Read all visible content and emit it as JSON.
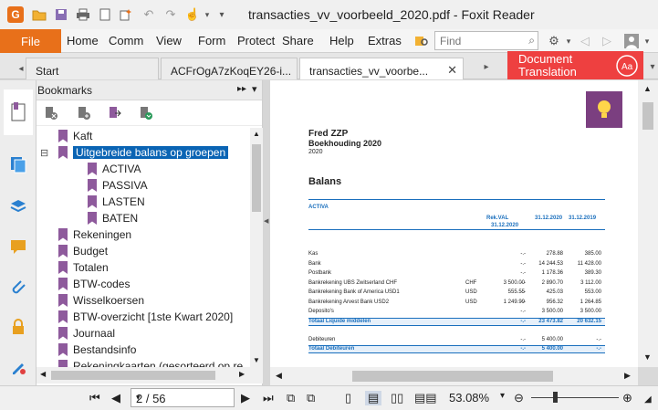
{
  "window": {
    "title": "transacties_vv_voorbeeld_2020.pdf - Foxit Reader"
  },
  "menu": {
    "file": "File",
    "items": [
      "Home",
      "Comm",
      "View",
      "Form",
      "Protect",
      "Share",
      "Help",
      "Extras"
    ],
    "find_placeholder": "Find"
  },
  "tabs": [
    {
      "label": "Start",
      "active": false
    },
    {
      "label": "ACFrOgA7zKoqEY26-i...",
      "active": false
    },
    {
      "label": "transacties_vv_voorbe...",
      "active": true
    }
  ],
  "doc_translation": {
    "line1": "Document",
    "line2": "Translation"
  },
  "bookmarks": {
    "title": "Bookmarks",
    "items": [
      {
        "label": "Kaft",
        "level": 0,
        "selected": false
      },
      {
        "label": "Uitgebreide balans op groepen",
        "level": 0,
        "selected": true,
        "expanded": true
      },
      {
        "label": "ACTIVA",
        "level": 1,
        "selected": false
      },
      {
        "label": "PASSIVA",
        "level": 1,
        "selected": false
      },
      {
        "label": "LASTEN",
        "level": 1,
        "selected": false
      },
      {
        "label": "BATEN",
        "level": 1,
        "selected": false
      },
      {
        "label": "Rekeningen",
        "level": 0,
        "selected": false
      },
      {
        "label": "Budget",
        "level": 0,
        "selected": false
      },
      {
        "label": "Totalen",
        "level": 0,
        "selected": false
      },
      {
        "label": "BTW-codes",
        "level": 0,
        "selected": false
      },
      {
        "label": "Wisselkoersen",
        "level": 0,
        "selected": false
      },
      {
        "label": "BTW-overzicht [1ste Kwart 2020]",
        "level": 0,
        "selected": false
      },
      {
        "label": "Journaal",
        "level": 0,
        "selected": false
      },
      {
        "label": "Bestandsinfo",
        "level": 0,
        "selected": false
      },
      {
        "label": "Rekeningkaarten (gesorteerd op re",
        "level": 0,
        "selected": false
      }
    ]
  },
  "document": {
    "company": "Fred ZZP",
    "subtitle": "Boekhouding 2020",
    "year": "2020",
    "heading": "Balans",
    "section": "ACTIVA",
    "col_rekval": "Rek.VAL",
    "col_rekval_date": "31.12.2020",
    "col_2020": "31.12.2020",
    "col_2019": "31.12.2019",
    "rows": [
      {
        "name": "Kas",
        "cur": "",
        "val": "",
        "d": "-.-",
        "y1": "278.88",
        "y2": "385.00"
      },
      {
        "name": "Bank",
        "cur": "",
        "val": "",
        "d": "-.-",
        "y1": "14 244.53",
        "y2": "11 428.00"
      },
      {
        "name": "Postbank",
        "cur": "",
        "val": "",
        "d": "-.-",
        "y1": "1 178.36",
        "y2": "389.30"
      },
      {
        "name": "Bankrekening UBS Zwitserland CHF",
        "cur": "CHF",
        "val": "3 500.00",
        "d": "-.-",
        "y1": "2 890.70",
        "y2": "3 112.00"
      },
      {
        "name": "Bankrekening Bank of America USD1",
        "cur": "USD",
        "val": "555.55",
        "d": "-.-",
        "y1": "425.03",
        "y2": "553.00"
      },
      {
        "name": "Bankrekening Arvest Bank USD2",
        "cur": "USD",
        "val": "1 249.99",
        "d": "-.-",
        "y1": "956.32",
        "y2": "1 264.85"
      },
      {
        "name": "Deposito's",
        "cur": "",
        "val": "",
        "d": "-.-",
        "y1": "3 500.00",
        "y2": "3 500.00"
      }
    ],
    "total1": {
      "name": "Totaal Liquide middelen",
      "d": "-.-",
      "y1": "23 473.82",
      "y2": "20 632.15"
    },
    "rows2": [
      {
        "name": "Debiteuren",
        "d": "-.-",
        "y1": "5 400.00",
        "y2": "-.-"
      }
    ],
    "total2": {
      "name": "Totaal Debiteuren",
      "d": "-.-",
      "y1": "5 400.00",
      "y2": "-.-"
    }
  },
  "status": {
    "page": "2 / 56",
    "zoom": "53.08%"
  },
  "colors": {
    "accent": "#e8701a",
    "selection": "#0a64b4",
    "bookmark": "#8e5a9c",
    "translation": "#ee4040",
    "pdf_blue": "#1a6fbd"
  }
}
